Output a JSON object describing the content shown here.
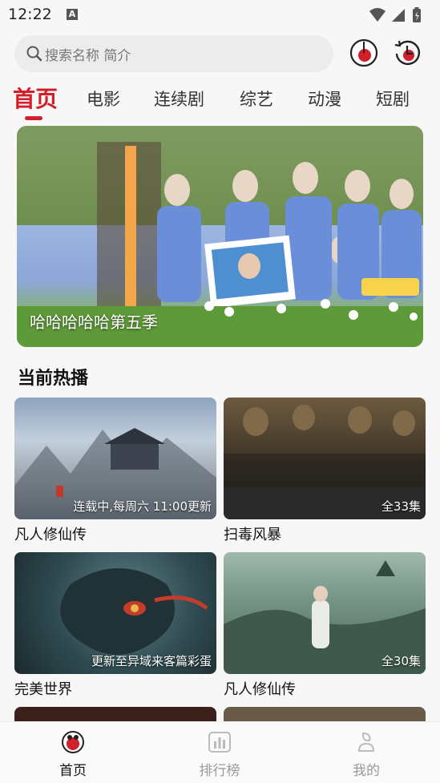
{
  "status_bar": {
    "time": "12:22"
  },
  "search": {
    "placeholder": "搜索名称 简介"
  },
  "tabs": [
    {
      "label": "首页",
      "active": true
    },
    {
      "label": "电影"
    },
    {
      "label": "连续剧"
    },
    {
      "label": "综艺"
    },
    {
      "label": "动漫"
    },
    {
      "label": "短剧"
    }
  ],
  "banner": {
    "title": "哈哈哈哈哈第五季"
  },
  "section": {
    "title": "当前热播"
  },
  "cards": [
    {
      "title": "凡人修仙传",
      "badge": "连载中,每周六 11:00更新"
    },
    {
      "title": "扫毒风暴",
      "badge": "全33集"
    },
    {
      "title": "完美世界",
      "badge": "更新至异域来客篇彩蛋"
    },
    {
      "title": "凡人修仙传",
      "badge": "全30集"
    }
  ],
  "bottom_nav": [
    {
      "label": "首页",
      "icon": "home-icon",
      "active": true
    },
    {
      "label": "排行榜",
      "icon": "ranking-icon"
    },
    {
      "label": "我的",
      "icon": "profile-icon"
    }
  ],
  "colors": {
    "accent": "#d11f2b"
  }
}
